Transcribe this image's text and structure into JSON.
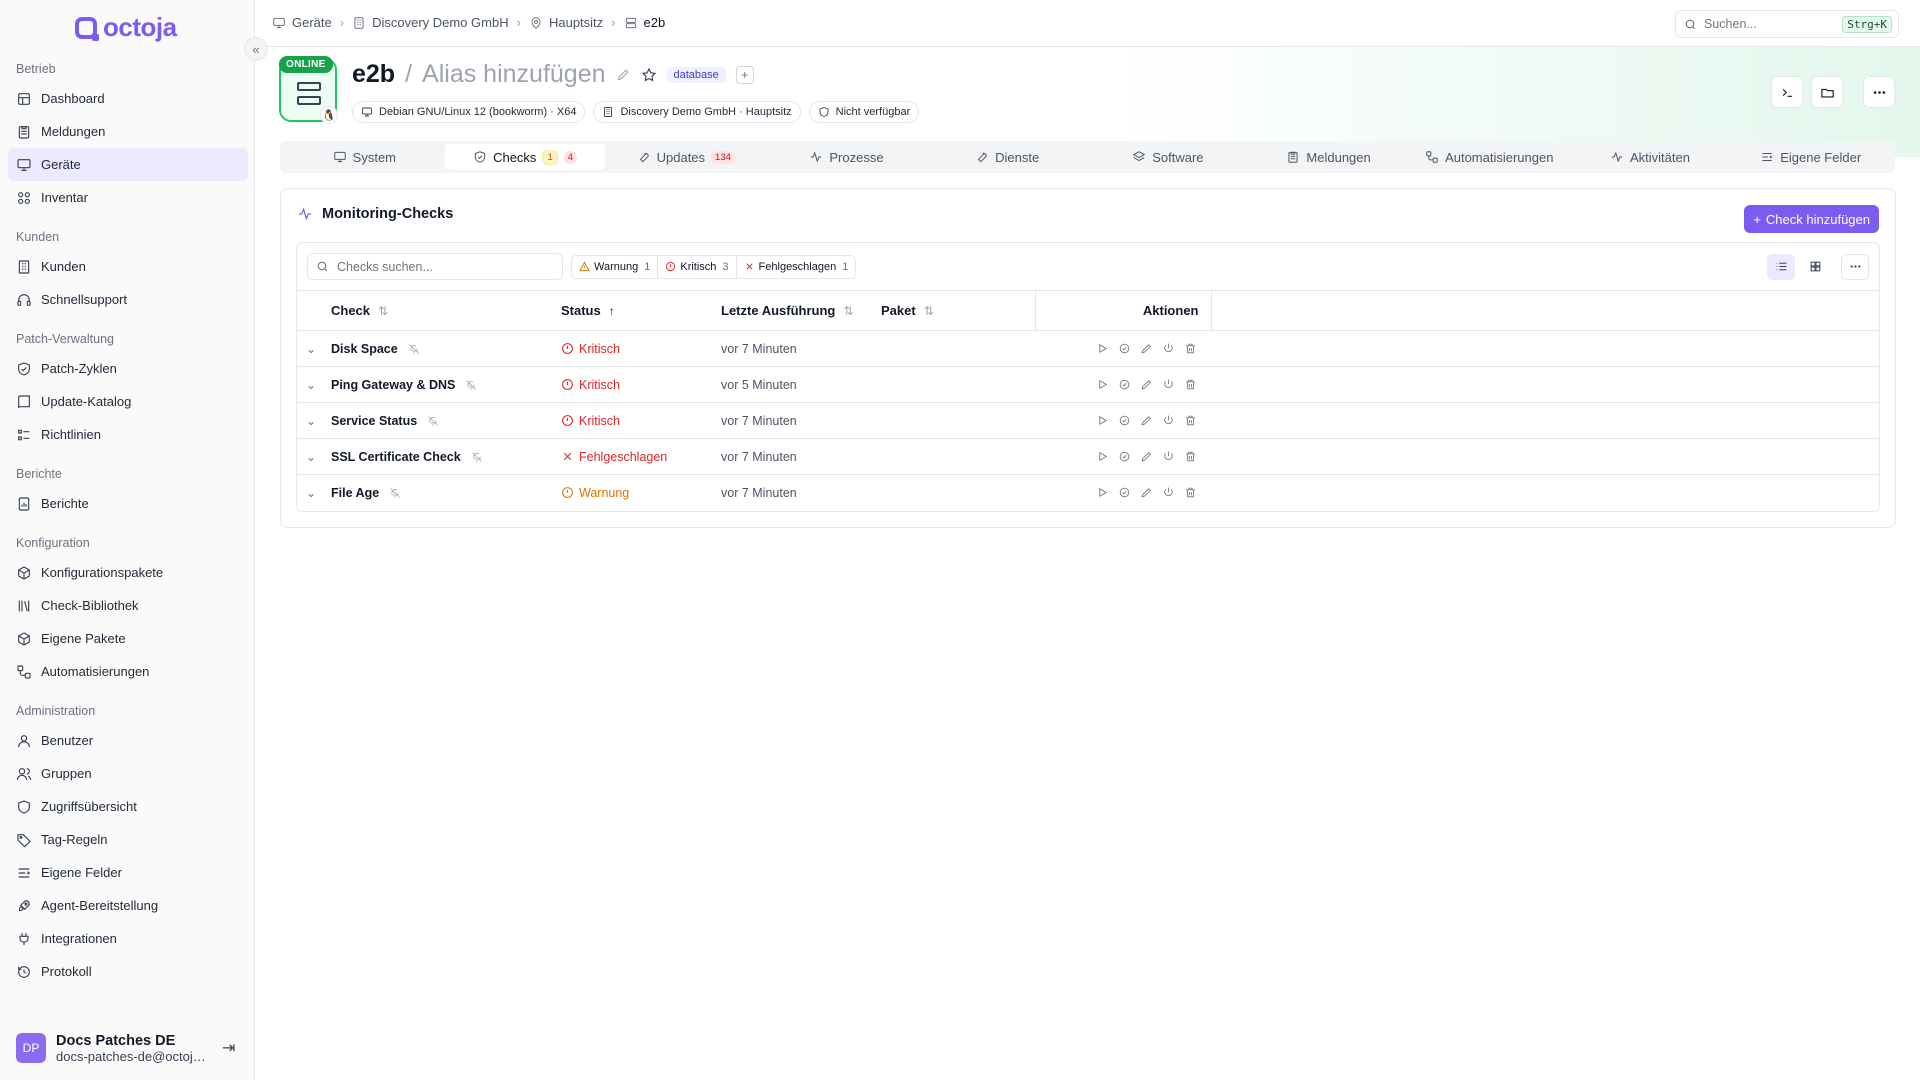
{
  "app": {
    "logo_text": "octoja",
    "accent": "#7c5cf0"
  },
  "sidebar": {
    "sections": [
      {
        "title": "Betrieb",
        "items": [
          {
            "label": "Dashboard",
            "icon": "dashboard-icon"
          },
          {
            "label": "Meldungen",
            "icon": "clipboard-icon"
          },
          {
            "label": "Geräte",
            "icon": "monitor-icon",
            "active": true
          },
          {
            "label": "Inventar",
            "icon": "boxes-icon"
          }
        ]
      },
      {
        "title": "Kunden",
        "items": [
          {
            "label": "Kunden",
            "icon": "building-icon"
          },
          {
            "label": "Schnellsupport",
            "icon": "headset-icon"
          }
        ]
      },
      {
        "title": "Patch-Verwaltung",
        "items": [
          {
            "label": "Patch-Zyklen",
            "icon": "shield-check-icon"
          },
          {
            "label": "Update-Katalog",
            "icon": "book-icon"
          },
          {
            "label": "Richtlinien",
            "icon": "list-icon"
          }
        ]
      },
      {
        "title": "Berichte",
        "items": [
          {
            "label": "Berichte",
            "icon": "report-icon"
          }
        ]
      },
      {
        "title": "Konfiguration",
        "items": [
          {
            "label": "Konfigurationspakete",
            "icon": "package-icon"
          },
          {
            "label": "Check-Bibliothek",
            "icon": "library-icon"
          },
          {
            "label": "Eigene Pakete",
            "icon": "package-icon"
          },
          {
            "label": "Automatisierungen",
            "icon": "workflow-icon"
          }
        ]
      },
      {
        "title": "Administration",
        "items": [
          {
            "label": "Benutzer",
            "icon": "user-icon"
          },
          {
            "label": "Gruppen",
            "icon": "users-icon"
          },
          {
            "label": "Zugriffsübersicht",
            "icon": "shield-icon"
          },
          {
            "label": "Tag-Regeln",
            "icon": "tag-icon"
          },
          {
            "label": "Eigene Felder",
            "icon": "fields-icon"
          },
          {
            "label": "Agent-Bereitstellung",
            "icon": "rocket-icon"
          },
          {
            "label": "Integrationen",
            "icon": "plug-icon"
          },
          {
            "label": "Protokoll",
            "icon": "history-icon"
          }
        ]
      }
    ],
    "user": {
      "initials": "DP",
      "name": "Docs Patches DE",
      "email": "docs-patches-de@octoja.com"
    }
  },
  "breadcrumb": [
    {
      "label": "Geräte",
      "icon": "monitor-icon"
    },
    {
      "label": "Discovery Demo GmbH",
      "icon": "building-icon"
    },
    {
      "label": "Hauptsitz",
      "icon": "map-pin-icon"
    },
    {
      "label": "e2b",
      "icon": "server-icon"
    }
  ],
  "search": {
    "placeholder": "Suchen...",
    "shortcut": "Strg+K"
  },
  "device": {
    "status": "ONLINE",
    "name": "e2b",
    "alias_placeholder": "Alias hinzufügen",
    "tag": "database",
    "tag_add": "+",
    "chips": [
      {
        "label": "Debian GNU/Linux 12 (bookworm) · X64",
        "icon": "monitor-icon"
      },
      {
        "label": "Discovery Demo GmbH · Hauptsitz",
        "icon": "building-icon"
      },
      {
        "label": "Nicht verfügbar",
        "icon": "shield-icon"
      }
    ]
  },
  "tabs": [
    {
      "label": "System",
      "icon": "monitor-icon"
    },
    {
      "label": "Checks",
      "icon": "shield-check-icon",
      "active": true,
      "warn": "1",
      "crit": "4"
    },
    {
      "label": "Updates",
      "icon": "wrench-icon",
      "crit": "134"
    },
    {
      "label": "Prozesse",
      "icon": "activity-icon"
    },
    {
      "label": "Dienste",
      "icon": "wrench-icon"
    },
    {
      "label": "Software",
      "icon": "layers-icon"
    },
    {
      "label": "Meldungen",
      "icon": "clipboard-icon"
    },
    {
      "label": "Automatisierungen",
      "icon": "workflow-icon"
    },
    {
      "label": "Aktivitäten",
      "icon": "activity-icon"
    },
    {
      "label": "Eigene Felder",
      "icon": "fields-icon"
    }
  ],
  "checks": {
    "title": "Monitoring-Checks",
    "add_label": "Check hinzufügen",
    "search_placeholder": "Checks suchen...",
    "filters": [
      {
        "label": "Warnung",
        "count": "1",
        "kind": "warn"
      },
      {
        "label": "Kritisch",
        "count": "3",
        "kind": "crit"
      },
      {
        "label": "Fehlgeschlagen",
        "count": "1",
        "kind": "fail"
      }
    ],
    "columns": {
      "check": "Check",
      "status": "Status",
      "last_run": "Letzte Ausführung",
      "package": "Paket",
      "actions": "Aktionen"
    },
    "rows": [
      {
        "name": "Disk Space",
        "status": "Kritisch",
        "kind": "crit",
        "last_run": "vor 7 Minuten",
        "package": ""
      },
      {
        "name": "Ping Gateway & DNS",
        "status": "Kritisch",
        "kind": "crit",
        "last_run": "vor 5 Minuten",
        "package": ""
      },
      {
        "name": "Service Status",
        "status": "Kritisch",
        "kind": "crit",
        "last_run": "vor 7 Minuten",
        "package": ""
      },
      {
        "name": "SSL Certificate Check",
        "status": "Fehlgeschlagen",
        "kind": "fail",
        "last_run": "vor 7 Minuten",
        "package": ""
      },
      {
        "name": "File Age",
        "status": "Warnung",
        "kind": "warn",
        "last_run": "vor 7 Minuten",
        "package": ""
      }
    ]
  }
}
